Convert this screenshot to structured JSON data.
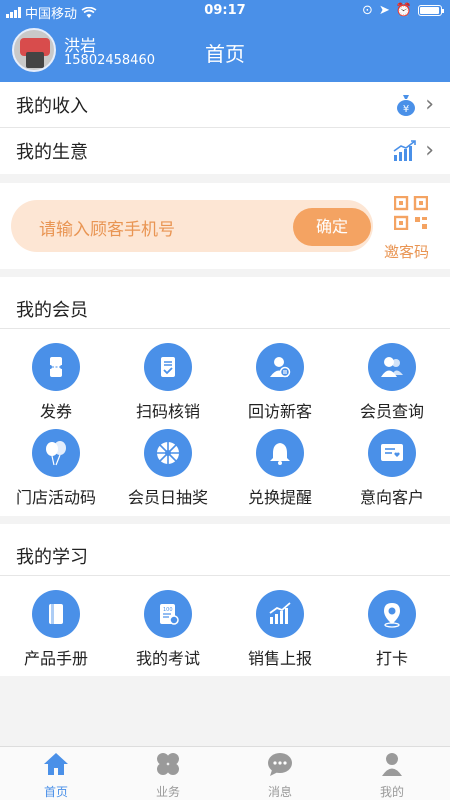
{
  "status": {
    "carrier": "中国移动",
    "time": "09:17"
  },
  "header": {
    "user_name": "洪岩",
    "user_phone": "15802458460",
    "title": "首页"
  },
  "menu": [
    {
      "label": "我的收入",
      "icon": "money-bag-icon"
    },
    {
      "label": "我的生意",
      "icon": "growth-chart-icon"
    }
  ],
  "search": {
    "placeholder": "请输入顾客手机号",
    "confirm_label": "确定",
    "qr_label": "邀客码"
  },
  "members": {
    "title": "我的会员",
    "items": [
      {
        "label": "发券",
        "icon": "coupon-icon"
      },
      {
        "label": "扫码核销",
        "icon": "scan-verify-icon"
      },
      {
        "label": "回访新客",
        "icon": "new-customer-icon"
      },
      {
        "label": "会员查询",
        "icon": "member-query-icon"
      },
      {
        "label": "门店活动码",
        "icon": "balloons-icon"
      },
      {
        "label": "会员日抽奖",
        "icon": "lottery-wheel-icon"
      },
      {
        "label": "兑换提醒",
        "icon": "bell-icon"
      },
      {
        "label": "意向客户",
        "icon": "intention-card-icon"
      }
    ]
  },
  "study": {
    "title": "我的学习",
    "items": [
      {
        "label": "产品手册",
        "icon": "manual-icon"
      },
      {
        "label": "我的考试",
        "icon": "exam-icon"
      },
      {
        "label": "销售上报",
        "icon": "sales-report-icon"
      },
      {
        "label": "打卡",
        "icon": "location-pin-icon"
      }
    ]
  },
  "tabs": [
    {
      "label": "首页",
      "icon": "home-icon",
      "active": true
    },
    {
      "label": "业务",
      "icon": "clover-icon",
      "active": false
    },
    {
      "label": "消息",
      "icon": "chat-bubble-icon",
      "active": false
    },
    {
      "label": "我的",
      "icon": "person-icon",
      "active": false
    }
  ],
  "colors": {
    "primary": "#4a90e8",
    "accent": "#f4a362",
    "accent_light": "#fde6d4",
    "accent_text": "#e99553"
  }
}
